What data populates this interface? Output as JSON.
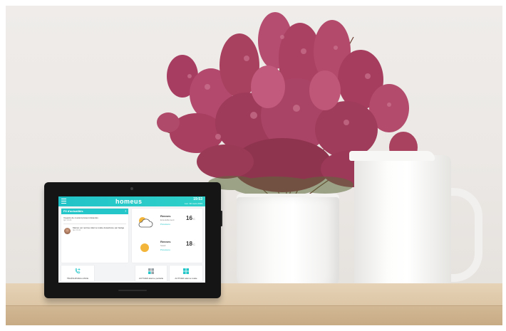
{
  "tablet": {
    "logo": "homeus",
    "clock": "19:53",
    "date": "Lun. 30 mars 2019",
    "news": {
      "header": "Fil d'actualités",
      "item1": "Voyants de courant présent détectés",
      "item1_time": "Ajd, 19:23",
      "item2": "Marion est rentrée Alarme totale désactivée par badge",
      "item2_time": "Ajd, 19:41"
    },
    "weather": [
      {
        "city": "Rennes",
        "condition": "Ensoleillement",
        "link": "Prévisions",
        "temp": "16",
        "unit": "°C"
      },
      {
        "city": "Rennes",
        "condition": "Soleil",
        "link": "Prévisions",
        "temp": "18",
        "unit": "°C"
      }
    ],
    "tiles": {
      "telecom": "TÉLÉSURVEILLANCE",
      "partial": "ACTIVER alarme partielle",
      "total": "ACTIVER alarme totale"
    }
  },
  "colors": {
    "accent": "#25c6c9",
    "flower": "#b0456a",
    "shelf": "#dcc6a6"
  }
}
